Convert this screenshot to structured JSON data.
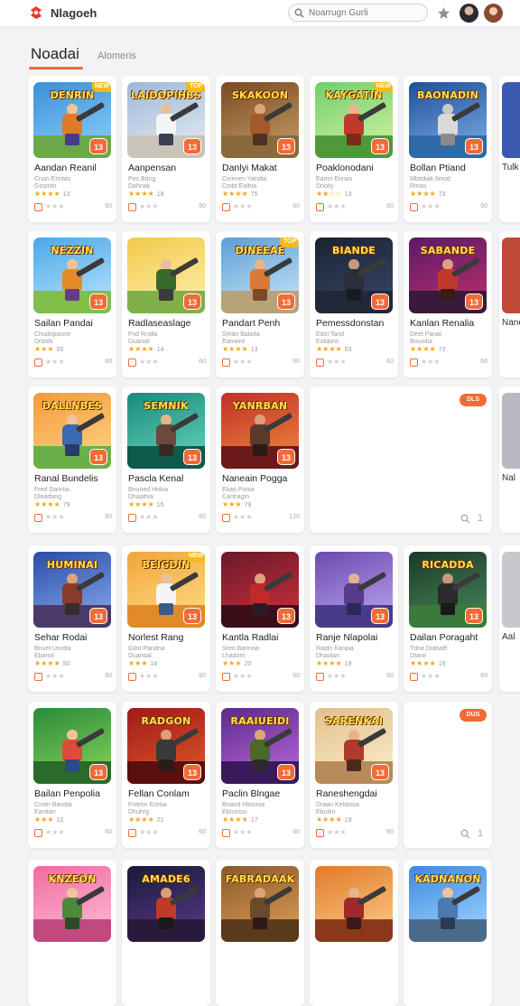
{
  "header": {
    "brand": "Nlagoeh",
    "search_placeholder": "Noarrugn Gurli",
    "star_icon": "star-icon",
    "avatars": [
      "user-avatar-1",
      "user-avatar-2"
    ]
  },
  "tabs": [
    {
      "label": "Noadai",
      "active": true
    },
    {
      "label": "Alomeris",
      "active": false
    }
  ],
  "cards": [
    {
      "title": "DENRIN",
      "name": "Aandan Reanil",
      "s1": "Cnan Ennlas",
      "s2": "Gosmtn",
      "stars": "★★★★",
      "rnum": "13",
      "badge": "13",
      "corner": "NEW",
      "count": "60",
      "sky": [
        "#3a8fd6",
        "#8fd3ff"
      ],
      "ground": "#6aa84a",
      "hero": "#e0792a",
      "skin": "#f1c39a",
      "legs": "#4a3a8a",
      "accent": "#f26a35"
    },
    {
      "title": "LAIDOPIHBS",
      "name": "Aanpensan",
      "s1": "Pos Bdng",
      "s2": "Dahnak",
      "stars": "★★★★",
      "rnum": "19",
      "badge": "13",
      "corner": "TOP",
      "count": "60",
      "sky": [
        "#9fb8d6",
        "#e7eef6"
      ],
      "ground": "#c9c3b8",
      "hero": "#f5f5f5",
      "skin": "#e9bf9b",
      "legs": "#3b3f52",
      "accent": "#f26a35"
    },
    {
      "title": "SKAKOON",
      "name": "Danlyi Makat",
      "s1": "Cinenen Yandia",
      "s2": "Cmbt Ealhia",
      "stars": "★★★★",
      "rnum": "75",
      "badge": "13",
      "corner": "",
      "count": "60",
      "sky": [
        "#7a4a22",
        "#c9a06a"
      ],
      "ground": "#8a6a3a",
      "hero": "#a55a2a",
      "skin": "#d9a679",
      "legs": "#4a3322",
      "accent": "#f26a35"
    },
    {
      "title": "KAYGATIN",
      "name": "Poaklonodani",
      "s1": "Eamn Ennas",
      "s2": "Dnoliy",
      "stars": "★★☆☆",
      "rnum": "13",
      "badge": "13",
      "corner": "NEW",
      "count": "60",
      "sky": [
        "#6fcf6a",
        "#d8f3a8"
      ],
      "ground": "#4e9a3a",
      "hero": "#c0392b",
      "skin": "#eab58a",
      "legs": "#7a2a1a",
      "accent": "#f26a35"
    },
    {
      "title": "BAONADIN",
      "name": "Bollan Ptiand",
      "s1": "Mbitdiak Ilinod",
      "s2": "Rinoo",
      "stars": "★★★★",
      "rnum": "73",
      "badge": "13",
      "corner": "",
      "count": "60",
      "sky": [
        "#1f4f9a",
        "#7fb0e8"
      ],
      "ground": "#2f6aa8",
      "hero": "#d9d9d9",
      "skin": "#c9c9c9",
      "legs": "#8a8a8a",
      "accent": "#f26a35"
    },
    {
      "title": "NEZZIN",
      "name": "Sailan Pandai",
      "s1": "Chudnpanne",
      "s2": "Droolti",
      "stars": "★★★",
      "rnum": "05",
      "badge": "13",
      "corner": "",
      "count": "60",
      "sky": [
        "#4aa8e8",
        "#bfe6ff"
      ],
      "ground": "#7fbf4a",
      "hero": "#e58a2a",
      "skin": "#f1c39a",
      "legs": "#6a3a8a",
      "accent": "#f26a35"
    },
    {
      "title": "",
      "name": "Radlaseaslage",
      "s1": "Fnd Rndla",
      "s2": "Duanial",
      "stars": "★★★★",
      "rnum": "14",
      "badge": "13",
      "corner": "",
      "count": "60",
      "sky": [
        "#f2c94c",
        "#fff1b0"
      ],
      "ground": "#7fb04a",
      "hero": "#3a6a2a",
      "skin": "#e9bf9b",
      "legs": "#3a3a3a",
      "accent": "#f26a35"
    },
    {
      "title": "DINEEAE",
      "name": "Pandart Penh",
      "s1": "Sman Baliota",
      "s2": "Eanwint",
      "stars": "★★★★",
      "rnum": "13",
      "badge": "13",
      "corner": "TOP",
      "count": "60",
      "sky": [
        "#5aa0d6",
        "#cfe7f8"
      ],
      "ground": "#b8a27a",
      "hero": "#d97a3a",
      "skin": "#e6b48a",
      "legs": "#7a4a2a",
      "accent": "#f26a35"
    },
    {
      "title": "BIANDE",
      "name": "Pemessdonstan",
      "s1": "Edol Tand",
      "s2": "Ealdonn",
      "stars": "★★★★",
      "rnum": "63",
      "badge": "13",
      "corner": "",
      "count": "60",
      "sky": [
        "#1b2233",
        "#3a4a6a"
      ],
      "ground": "#22283a",
      "hero": "#2a2f3a",
      "skin": "#c99a7a",
      "legs": "#1a1a22",
      "accent": "#f26a35"
    },
    {
      "title": "SABANDE",
      "name": "Kanlan Renalia",
      "s1": "Deet Panat",
      "s2": "Bounilia",
      "stars": "★★★★",
      "rnum": "73",
      "badge": "13",
      "corner": "",
      "count": "60",
      "sky": [
        "#5a1a6a",
        "#c0306a"
      ],
      "ground": "#3a1a3a",
      "hero": "#c0392b",
      "skin": "#e0a080",
      "legs": "#3a1a1a",
      "accent": "#f26a35"
    },
    {
      "title": "DALLNBES",
      "name": "Ranal Bundelis",
      "s1": "Fred Danrtia",
      "s2": "Dlearbing",
      "stars": "★★★★",
      "rnum": "79",
      "badge": "13",
      "corner": "",
      "count": "60",
      "sky": [
        "#f29a3a",
        "#ffd88a"
      ],
      "ground": "#6ab04a",
      "hero": "#3a6ab0",
      "skin": "#f1c39a",
      "legs": "#2a3a6a",
      "accent": "#f26a35"
    },
    {
      "title": "SEMNIK",
      "name": "Pascla Kenal",
      "s1": "Bnuned Hnkia",
      "s2": "Dhaalhia",
      "stars": "★★★★",
      "rnum": "15",
      "badge": "13",
      "corner": "",
      "count": "60",
      "sky": [
        "#1a8a7a",
        "#6ad6c0"
      ],
      "ground": "#0f5a4a",
      "hero": "#6a4a3a",
      "skin": "#e6b48a",
      "legs": "#3a2a22",
      "accent": "#f26a35"
    },
    {
      "title": "YANRBAN",
      "name": "Naneain Pogga",
      "s1": "Ekao Ponia",
      "s2": "Canhagin",
      "stars": "★★★",
      "rnum": "79",
      "badge": "13",
      "corner": "",
      "count": "120",
      "sky": [
        "#c0302a",
        "#f28a3a"
      ],
      "ground": "#6a1a1a",
      "hero": "#5a3a2a",
      "skin": "#d9a079",
      "legs": "#2a1a1a",
      "accent": "#f26a35"
    },
    {
      "title": "HUMINAI",
      "name": "Sehar Rodai",
      "s1": "Bnuel Unrdia",
      "s2": "Ebaroil",
      "stars": "★★★★",
      "rnum": "50",
      "badge": "13",
      "corner": "",
      "count": "60",
      "sky": [
        "#2a4aa8",
        "#8ab0f0"
      ],
      "ground": "#4a3a6a",
      "hero": "#8a3a2a",
      "skin": "#d9a679",
      "legs": "#3a2a2a",
      "accent": "#f26a35"
    },
    {
      "title": "BEIGDIN",
      "name": "Norlest Rang",
      "s1": "Gilnt Pandria",
      "s2": "Duansal",
      "stars": "★★★",
      "rnum": "14",
      "badge": "13",
      "corner": "NEW",
      "count": "60",
      "sky": [
        "#f2a43a",
        "#ffe08a"
      ],
      "ground": "#e08a2a",
      "hero": "#f5f5f5",
      "skin": "#eac09a",
      "legs": "#3a5a8a",
      "accent": "#f26a35"
    },
    {
      "title": "",
      "name": "Kantla Radlai",
      "s1": "Sren Banroia",
      "s2": "Lhadorn",
      "stars": "★★★",
      "rnum": "20",
      "badge": "13",
      "corner": "",
      "count": "60",
      "sky": [
        "#6a1a2a",
        "#d0303a"
      ],
      "ground": "#3a0f1a",
      "hero": "#c02a2a",
      "skin": "#e0a080",
      "legs": "#2a1a2a",
      "accent": "#f26a35"
    },
    {
      "title": "",
      "name": "Ranje Nlapolai",
      "s1": "Raldn Kanpia",
      "s2": "Dhaolan",
      "stars": "★★★★",
      "rnum": "19",
      "badge": "13",
      "corner": "",
      "count": "60",
      "sky": [
        "#6a4ab0",
        "#c0a8f0"
      ],
      "ground": "#4a3a8a",
      "hero": "#5a3a8a",
      "skin": "#e6b48a",
      "legs": "#2a2a5a",
      "accent": "#f26a35"
    },
    {
      "title": "RICADDA",
      "name": "Dailan Poragaht",
      "s1": "Tdna Diahalfl",
      "s2": "Olanil",
      "stars": "★★★★",
      "rnum": "19",
      "badge": "13",
      "corner": "",
      "count": "60",
      "sky": [
        "#1a3a2a",
        "#4a8a5a"
      ],
      "ground": "#3a7a3a",
      "hero": "#2a2a2a",
      "skin": "#c99a7a",
      "legs": "#1a1a1a",
      "accent": "#f26a35"
    },
    {
      "title": "",
      "name": "Bailan Penpolia",
      "s1": "Cintin Bandia",
      "s2": "Eanitan",
      "stars": "★★★",
      "rnum": "10",
      "badge": "13",
      "corner": "",
      "count": "60",
      "sky": [
        "#2a8a3a",
        "#8ad65a"
      ],
      "ground": "#2a6a2a",
      "hero": "#e04a3a",
      "skin": "#f1c39a",
      "legs": "#2a4a8a",
      "accent": "#f26a35"
    },
    {
      "title": "RADGON",
      "name": "Fellan Conlam",
      "s1": "Fnlerin Ennlai",
      "s2": "Dhuhrg",
      "stars": "★★★★",
      "rnum": "21",
      "badge": "13",
      "corner": "",
      "count": "60",
      "sky": [
        "#a01a1a",
        "#e05a2a"
      ],
      "ground": "#5a0f0f",
      "hero": "#3a3a3a",
      "skin": "#d9a079",
      "legs": "#2a1a1a",
      "accent": "#f26a35"
    },
    {
      "title": "RAAIUEIDI",
      "name": "Paclin Blngae",
      "s1": "Bnand Hlisonia",
      "s2": "Ebnsrosi",
      "stars": "★★★★",
      "rnum": "17",
      "badge": "13",
      "corner": "",
      "count": "60",
      "sky": [
        "#5a2a8a",
        "#c06ae0"
      ],
      "ground": "#3a1a5a",
      "hero": "#4a6a2a",
      "skin": "#d9a679",
      "legs": "#2a2a2a",
      "accent": "#f26a35"
    },
    {
      "title": "SARENKAI",
      "name": "Raneshengdai",
      "s1": "Draan Keldsioa",
      "s2": "Ebutlin",
      "stars": "★★★★",
      "rnum": "19",
      "badge": "13",
      "corner": "",
      "count": "60",
      "sky": [
        "#e0c08a",
        "#fff0d0"
      ],
      "ground": "#b88a5a",
      "hero": "#b03a2a",
      "skin": "#e6b48a",
      "legs": "#4a2a1a",
      "accent": "#f26a35"
    },
    {
      "title": "KNZEON",
      "name": "",
      "s1": "",
      "s2": "",
      "stars": "",
      "rnum": "",
      "badge": "",
      "corner": "",
      "count": "",
      "sky": [
        "#f06aa0",
        "#ffc0d8"
      ],
      "ground": "#c04a80",
      "hero": "#4a8a3a",
      "skin": "#f1c39a",
      "legs": "#2a4a2a",
      "accent": "#f26a35"
    },
    {
      "title": "AMADE6",
      "name": "",
      "s1": "",
      "s2": "",
      "stars": "",
      "rnum": "",
      "badge": "",
      "corner": "",
      "count": "",
      "sky": [
        "#1a1a3a",
        "#5a3a8a"
      ],
      "ground": "#2a1a3a",
      "hero": "#c03a2a",
      "skin": "#d9a079",
      "legs": "#1a1a1a",
      "accent": "#f26a35"
    },
    {
      "title": "FABRADAAK",
      "name": "",
      "s1": "",
      "s2": "",
      "stars": "",
      "rnum": "",
      "badge": "",
      "corner": "",
      "count": "",
      "sky": [
        "#8a5a2a",
        "#e0a05a"
      ],
      "ground": "#5a3a1a",
      "hero": "#6a4a2a",
      "skin": "#d9a679",
      "legs": "#2a1a1a",
      "accent": "#f26a35"
    },
    {
      "title": "",
      "name": "",
      "s1": "",
      "s2": "",
      "stars": "",
      "rnum": "",
      "badge": "",
      "corner": "",
      "count": "",
      "sky": [
        "#e07a2a",
        "#ffd08a"
      ],
      "ground": "#8a3a1a",
      "hero": "#a02a2a",
      "skin": "#e6b48a",
      "legs": "#3a1a1a",
      "accent": "#f26a35"
    },
    {
      "title": "KADNANON",
      "name": "",
      "s1": "",
      "s2": "",
      "stars": "",
      "rnum": "",
      "badge": "",
      "corner": "",
      "count": "",
      "sky": [
        "#3a8ae0",
        "#a8d8ff"
      ],
      "ground": "#4a6a8a",
      "hero": "#4a7ab0",
      "skin": "#f1c39a",
      "legs": "#2a3a5a",
      "accent": "#f26a35"
    }
  ],
  "wide_cards": [
    {
      "pill": "DLS",
      "count": "1"
    },
    {
      "pill": "DUS",
      "count": "1"
    }
  ],
  "peek_cards": [
    {
      "name": "Tulk"
    },
    {
      "name": "Nane"
    },
    {
      "name": "Nal"
    },
    {
      "name": "Aal"
    }
  ]
}
